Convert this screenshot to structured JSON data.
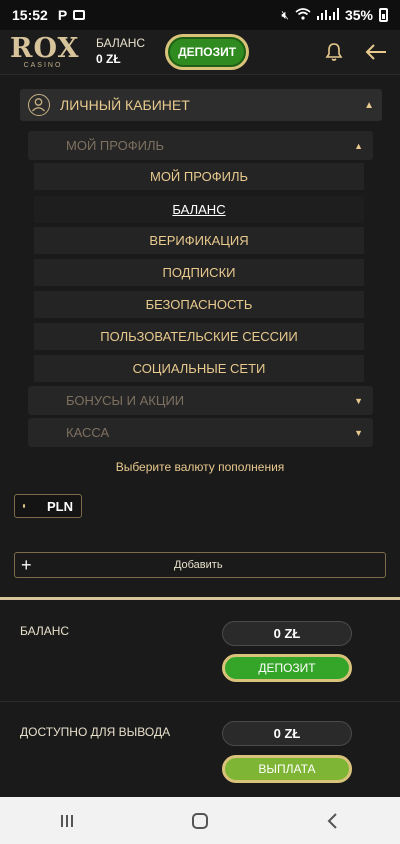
{
  "status": {
    "time": "15:52",
    "p": "P",
    "battery": "35%"
  },
  "header": {
    "logo_main": "ROX",
    "logo_sub": "CASINO",
    "balance_label": "БАЛАНС",
    "balance_value": "0 ZŁ",
    "deposit_label": "ДЕПОЗИТ"
  },
  "menu": {
    "title": "ЛИЧНЫЙ КАБИНЕТ",
    "sections": [
      {
        "label": "МОЙ ПРОФИЛЬ"
      },
      {
        "label": "БОНУСЫ И АКЦИИ"
      },
      {
        "label": "КАССА"
      }
    ],
    "profile_items": [
      {
        "label": "МОЙ ПРОФИЛЬ"
      },
      {
        "label": "БАЛАНС"
      },
      {
        "label": "ВЕРИФИКАЦИЯ"
      },
      {
        "label": "ПОДПИСКИ"
      },
      {
        "label": "БЕЗОПАСНОСТЬ"
      },
      {
        "label": "ПОЛЬЗОВАТЕЛЬСКИЕ СЕССИИ"
      },
      {
        "label": "СОЦИАЛЬНЫЕ СЕТИ"
      }
    ]
  },
  "currency": {
    "hint": "Выберите валюту пополнения",
    "selected": "PLN",
    "add_label": "Добавить"
  },
  "summary": {
    "balance_label": "БАЛАНС",
    "balance_value": "0 ZŁ",
    "deposit_label": "ДЕПОЗИТ",
    "withdraw_label": "ДОСТУПНО ДЛЯ ВЫВОДА",
    "withdraw_value": "0 ZŁ",
    "payout_label": "ВЫПЛАТА"
  },
  "colors": {
    "accent": "#e8c98e",
    "deposit_green": "#35a52a",
    "payout_lime": "#7fb535",
    "gold_border": "#d9c27a"
  },
  "icons": [
    "user-icon",
    "bell-icon",
    "back-arrow-icon",
    "caret-up-icon",
    "caret-down-icon",
    "plus-icon",
    "recents-icon",
    "home-icon",
    "nav-back-icon"
  ]
}
